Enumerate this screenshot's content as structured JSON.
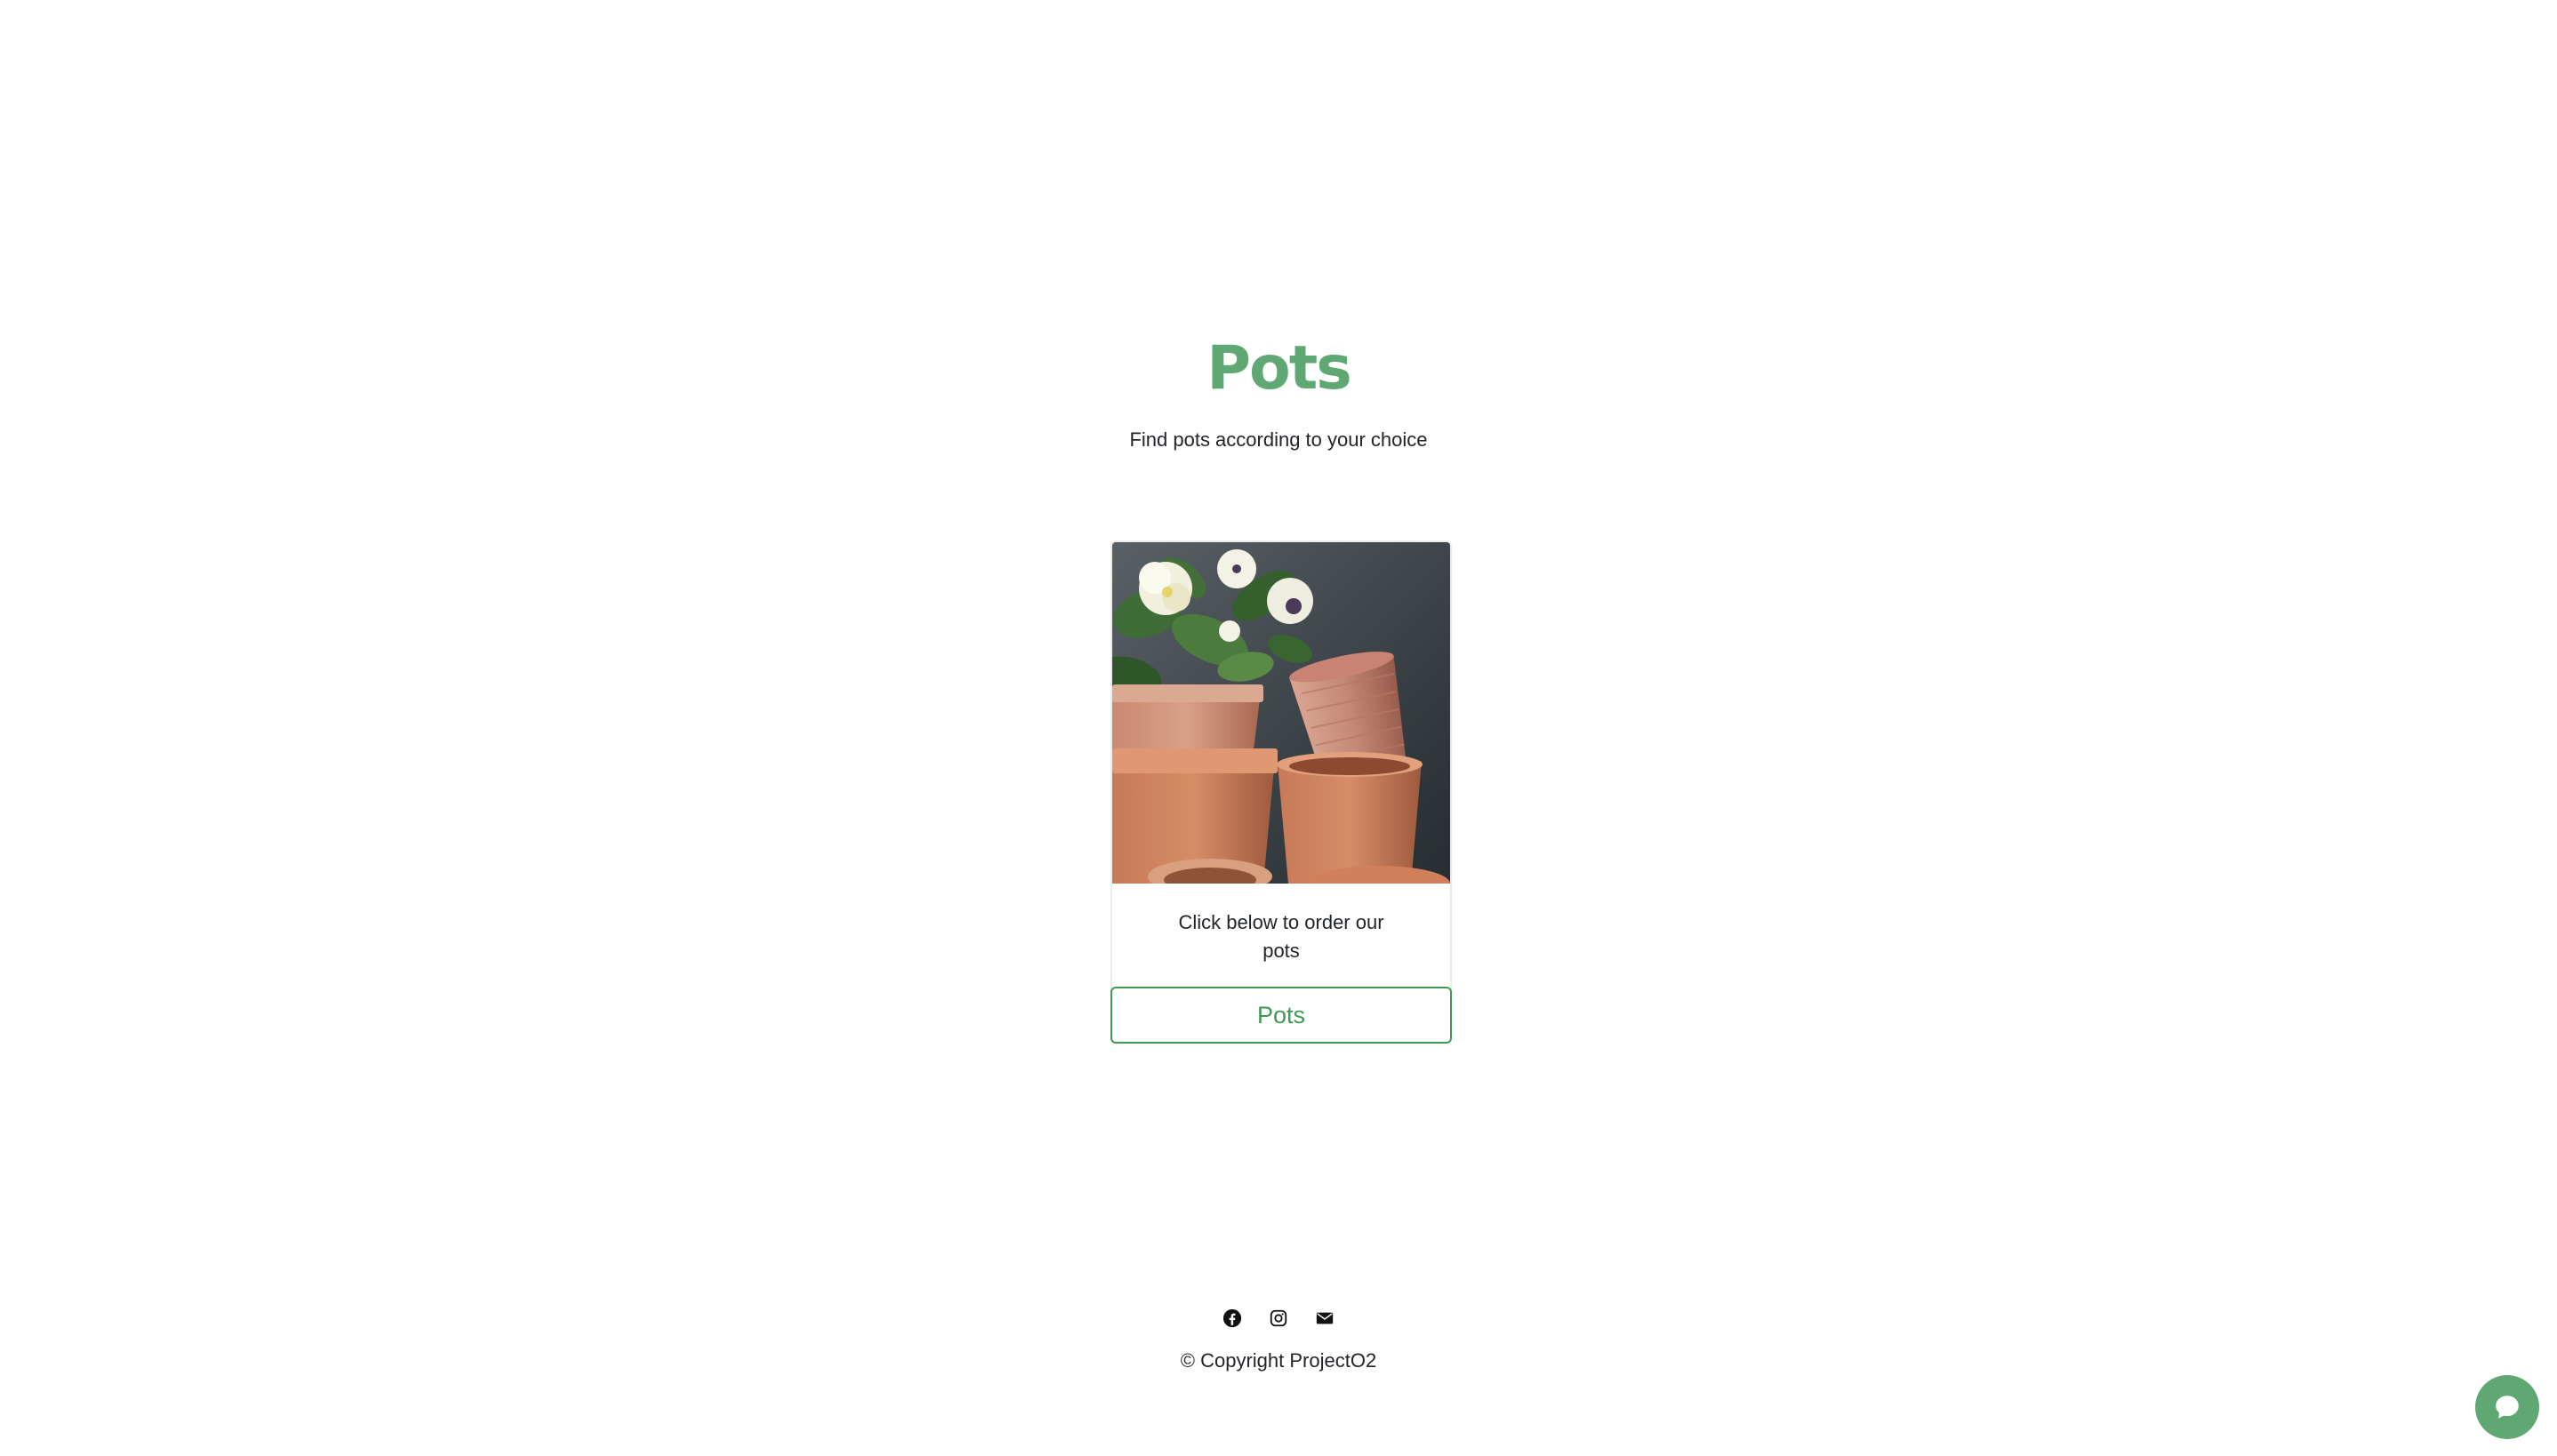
{
  "header": {
    "title": "Pots",
    "subtitle": "Find pots according to your choice"
  },
  "card": {
    "text": "Click below to order our pots",
    "button_label": "Pots"
  },
  "footer": {
    "icons": [
      "facebook-icon",
      "instagram-icon",
      "envelope-icon"
    ],
    "copyright": "© Copyright ProjectO2"
  },
  "chat": {
    "icon": "chat-bubble-icon"
  },
  "colors": {
    "accent": "#5fa873",
    "button": "#3d9a50"
  }
}
